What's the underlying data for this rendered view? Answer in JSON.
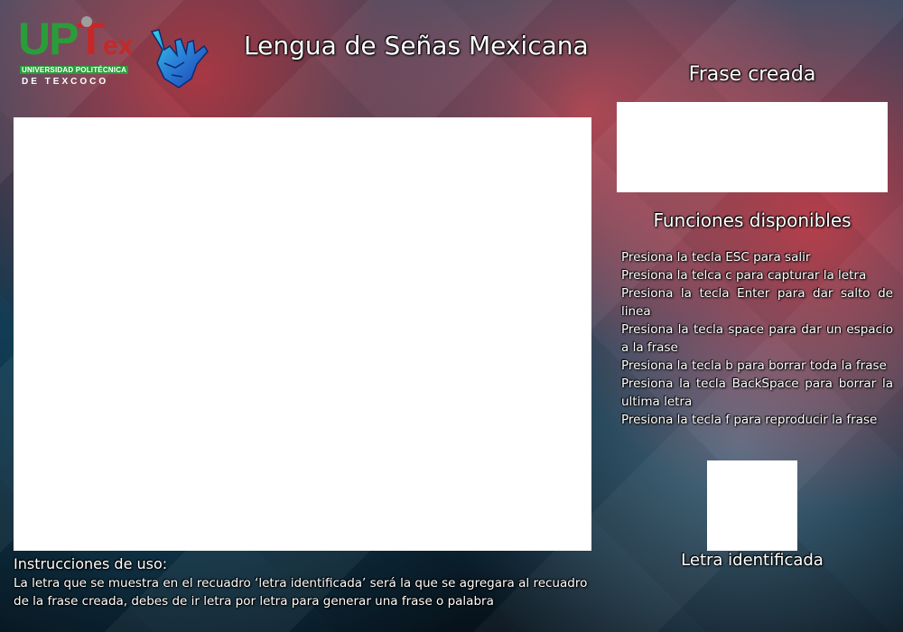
{
  "header": {
    "title": "Lengua de Señas Mexicana",
    "logo": {
      "mark_u": "U",
      "mark_p": "P",
      "mark_t": "T",
      "mark_ex": "ex",
      "line1": "UNIVERSIDAD POLITÉCNICA",
      "line2": "DE TEXCOCO"
    },
    "hand_icon": "sign-language-hand-icon"
  },
  "right_panel": {
    "frase_title": "Frase creada",
    "funciones_title": "Funciones disponibles",
    "funciones": [
      "Presiona la tecla ESC para salir",
      "Presiona la telca c para capturar la letra",
      "Presiona la tecla Enter para dar salto de linea",
      "Presiona la tecla space para dar un espacio a la frase",
      "Presiona la tecla b para borrar toda la frase",
      "Presiona la tecla BackSpace para borrar la ultima letra",
      "Presiona la tecla f para reproducir la frase"
    ],
    "letra_label": "Letra identificada"
  },
  "instructions": {
    "title": "Instrucciones de uso:",
    "body": "La letra que se muestra en el recuadro ‘letra identificada’ será la que se agregara al recuadro de la frase creada, debes de ir letra por letra para generar una frase o palabra"
  },
  "colors": {
    "logo_green": "#2a9d3a",
    "logo_red": "#c62828",
    "panel_white": "#ffffff",
    "background_red": "#d23c46",
    "background_blue": "#0e3247"
  }
}
